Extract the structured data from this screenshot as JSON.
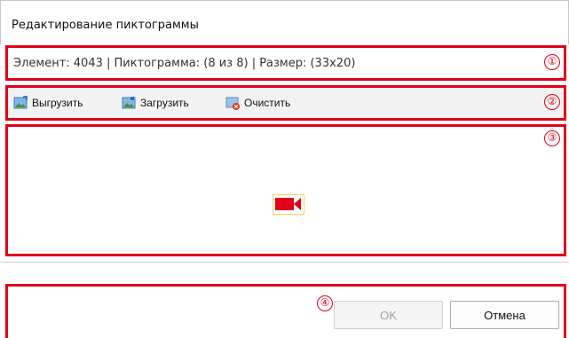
{
  "dialog": {
    "title": "Редактирование пиктограммы"
  },
  "info": {
    "text": "Элемент: 4043 | Пиктограмма: (8 из 8) | Размер: (33x20)"
  },
  "toolbar": {
    "export_label": "Выгрузить",
    "import_label": "Загрузить",
    "clear_label": "Очистить"
  },
  "buttons": {
    "ok_label": "OK",
    "cancel_label": "Отмена"
  },
  "markers": {
    "m1": "①",
    "m2": "②",
    "m3": "③",
    "m4": "④"
  },
  "colors": {
    "highlight": "#e2001a",
    "icon_fill": "#e2001a",
    "selection": "#f2c400"
  },
  "icons": {
    "pictogram": "video-camera-icon",
    "export": "image-export-icon",
    "import": "image-import-icon",
    "clear": "image-clear-icon"
  }
}
